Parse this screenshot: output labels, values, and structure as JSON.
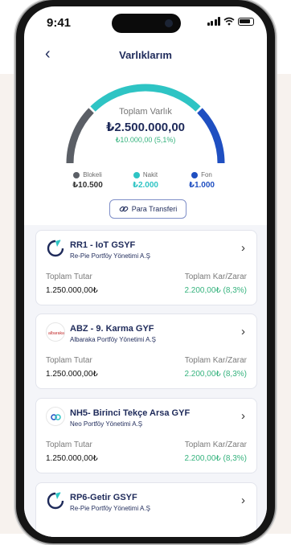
{
  "status_bar": {
    "time": "9:41"
  },
  "header": {
    "title": "Varlıklarım"
  },
  "summary": {
    "label": "Toplam Varlık",
    "amount": "₺2.500.000,00",
    "change": "₺10.000,00 (5,1%)",
    "segments": [
      {
        "name": "Blokeli",
        "value": "₺10.500",
        "color": "#5b5f66",
        "share": 0.25
      },
      {
        "name": "Nakit",
        "value": "₺2.000",
        "color": "#2ec4c4",
        "share": 0.5
      },
      {
        "name": "Fon",
        "value": "₺1.000",
        "color": "#1f4fc1",
        "share": 0.25
      }
    ]
  },
  "transfer_button": {
    "label": "Para Transferi"
  },
  "funds": [
    {
      "code": "RR1 - IoT GSYF",
      "company": "Re-Pie Portföy Yönetimi A.Ş",
      "total_label": "Toplam Tutar",
      "total": "1.250.000,00₺",
      "profit_label": "Toplam Kar/Zarar",
      "profit": "2.200,00₺ (8,3%)",
      "logo": "repie-logo"
    },
    {
      "code": "ABZ - 9. Karma GYF",
      "company": "Albaraka Portföy Yönetimi A.Ş",
      "total_label": "Toplam Tutar",
      "total": "1.250.000,00₺",
      "profit_label": "Toplam Kar/Zarar",
      "profit": "2.200,00₺ (8,3%)",
      "logo": "albaraka-logo",
      "logo_text": "albaraka"
    },
    {
      "code": "NH5- Birinci Tekçe Arsa GYF",
      "company": "Neo Portföy Yönetimi A.Ş",
      "total_label": "Toplam Tutar",
      "total": "1.250.000,00₺",
      "profit_label": "Toplam Kar/Zarar",
      "profit": "2.200,00₺ (8,3%)",
      "logo": "neo-logo"
    },
    {
      "code": "RP6-Getir GSYF",
      "company": "Re-Pie Portföy Yönetimi A.Ş",
      "logo": "repie-logo"
    }
  ],
  "colors": {
    "brand_navy": "#1e2a5a",
    "positive": "#36b37e"
  }
}
